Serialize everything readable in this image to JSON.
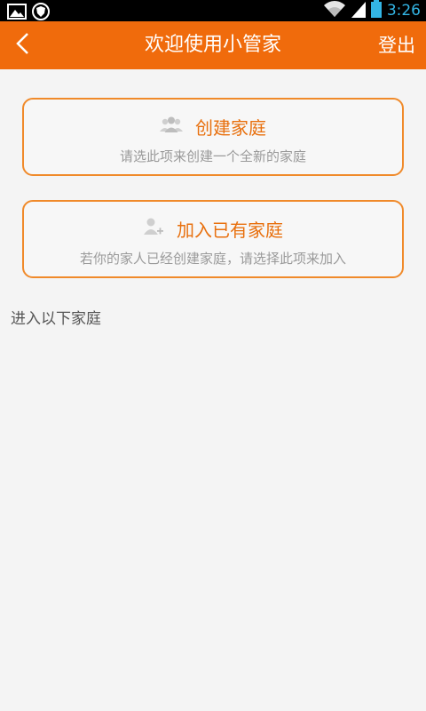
{
  "status_bar": {
    "time": "3:26",
    "icons": [
      "image-icon",
      "shield-icon",
      "wifi-icon",
      "signal-icon",
      "battery-icon"
    ]
  },
  "header": {
    "back_icon": "back-arrow-icon",
    "title": "欢迎使用小管家",
    "logout_label": "登出"
  },
  "options": [
    {
      "icon": "group-icon",
      "title": "创建家庭",
      "subtitle": "请选此项来创建一个全新的家庭"
    },
    {
      "icon": "add-user-icon",
      "title": "加入已有家庭",
      "subtitle": "若你的家人已经创建家庭，请选择此项来加入"
    }
  ],
  "section_label": "进入以下家庭",
  "colors": {
    "accent": "#f06b0c",
    "card_border": "#f08a2a",
    "card_title": "#e8700e",
    "status_time": "#33b5e5"
  }
}
